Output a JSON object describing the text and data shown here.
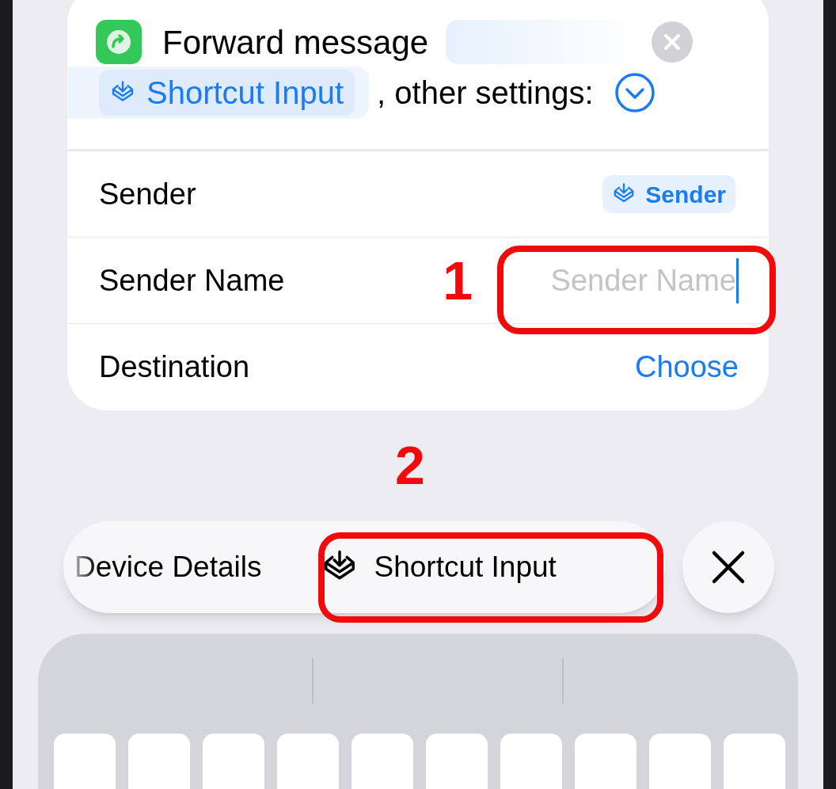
{
  "action": {
    "title": "Forward message",
    "input_token": "Shortcut Input",
    "trailing_text": ", other settings:"
  },
  "fields": [
    {
      "kind": "token",
      "label": "Sender",
      "value": "Sender"
    },
    {
      "kind": "text",
      "label": "Sender Name",
      "placeholder": "Sender Name",
      "focused": true
    },
    {
      "kind": "link",
      "label": "Destination",
      "value": "Choose"
    }
  ],
  "suggestions": [
    {
      "label": "Device Details",
      "has_icon": false
    },
    {
      "label": "Shortcut Input",
      "has_icon": true
    }
  ],
  "annotations": [
    {
      "label": "1"
    },
    {
      "label": "2"
    }
  ]
}
